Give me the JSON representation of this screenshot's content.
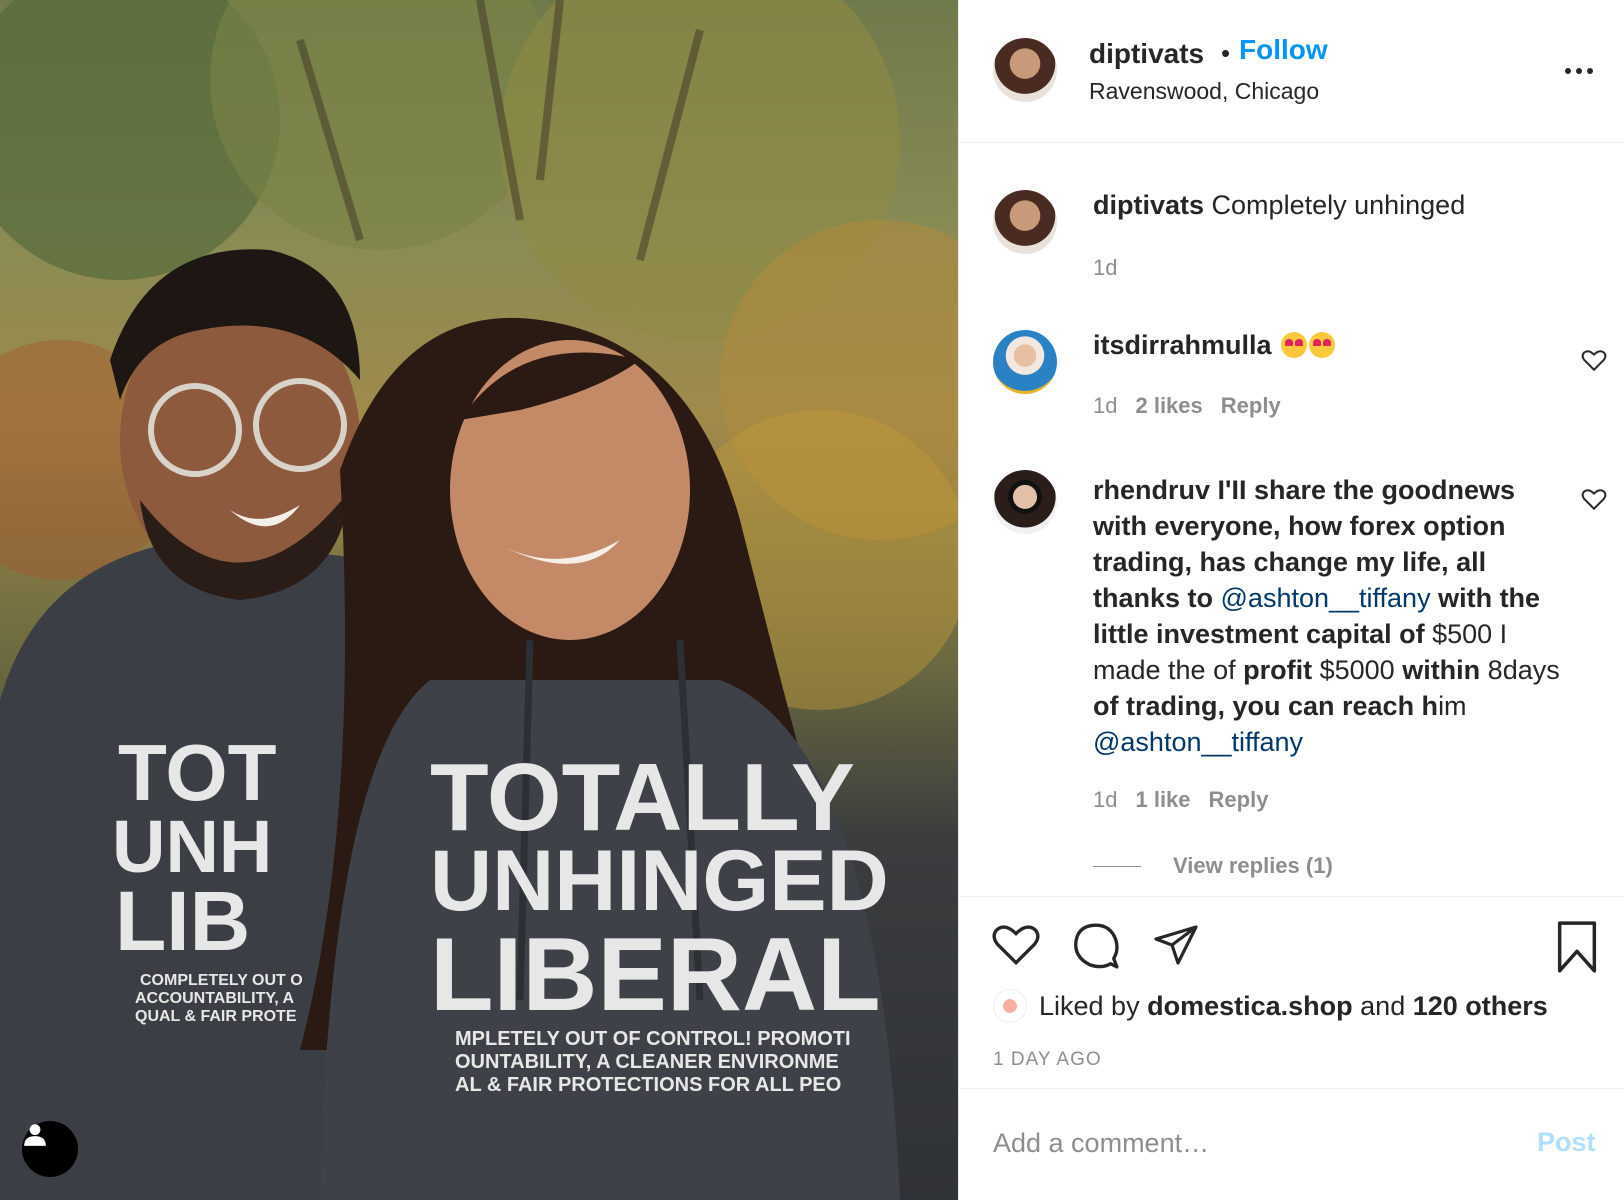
{
  "post": {
    "username": "diptivats",
    "follow_label": "Follow",
    "location": "Ravenswood, Chicago"
  },
  "photo": {
    "shirt_lines": [
      "TOTALLY",
      "UNHINGED",
      "LIBERAL"
    ],
    "shirt_small_lines": [
      "MPLETELY OUT OF CONTROL! PROMOTI",
      "OUNTABILITY, A CLEANER ENVIRONME",
      "AL & FAIR PROTECTIONS FOR ALL PEO"
    ],
    "left_shirt_lines": [
      "TOT",
      "UNH",
      "LIB"
    ],
    "left_shirt_small": [
      "COMPLETELY OUT O",
      "ACCOUNTABILITY, A",
      "QUAL & FAIR PROTE"
    ]
  },
  "caption": {
    "username": "diptivats",
    "text": "Completely unhinged",
    "time": "1d"
  },
  "comments": [
    {
      "username": "itsdirrahmulla",
      "time": "1d",
      "likes": "2 likes",
      "reply_label": "Reply"
    },
    {
      "username": "rhendruv",
      "segments": [
        {
          "t": "I'II share the goodnews with everyone, how forex option trading, has change my life, all thanks to ",
          "bold": true
        },
        {
          "t": "@ashton__tiffany",
          "mention": true
        },
        {
          "t": " with the little investment capital of ",
          "bold": true
        },
        {
          "t": "$500 I made the of "
        },
        {
          "t": "profit ",
          "bold": true
        },
        {
          "t": "$5000 "
        },
        {
          "t": "within ",
          "bold": true
        },
        {
          "t": "8days "
        },
        {
          "t": "of trading, you can reach h",
          "bold": true
        },
        {
          "t": "im "
        },
        {
          "t": "@ashton__tiffany",
          "mention": true
        }
      ],
      "time": "1d",
      "likes": "1 like",
      "reply_label": "Reply",
      "view_replies": "View replies (1)"
    }
  ],
  "likes": {
    "prefix": "Liked by ",
    "user": "domestica.shop",
    "and": " and ",
    "others": "120 others"
  },
  "timestamp": "1 DAY AGO",
  "add_comment": {
    "placeholder": "Add a comment…",
    "post_label": "Post"
  },
  "colors": {
    "follow": "#0095f6",
    "mention": "#00376b",
    "muted": "#8e8e8e",
    "post_disabled": "#b2dffc"
  }
}
